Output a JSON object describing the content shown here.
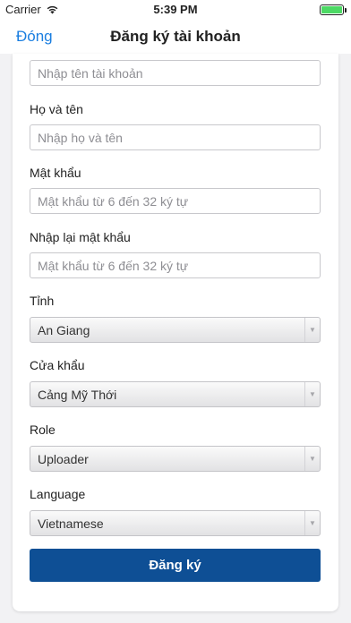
{
  "status_bar": {
    "carrier": "Carrier",
    "time": "5:39 PM",
    "battery_level": 1.0
  },
  "nav": {
    "back_label": "Đóng",
    "title": "Đăng ký tài khoản"
  },
  "form": {
    "username": {
      "placeholder": "Nhập tên tài khoản"
    },
    "fullname": {
      "label": "Họ và tên",
      "placeholder": "Nhập họ và tên"
    },
    "password": {
      "label": "Mật khẩu",
      "placeholder": "Mật khẩu từ 6 đến 32 ký tự"
    },
    "confirm_password": {
      "label": "Nhập lại mật khẩu",
      "placeholder": "Mật khẩu từ 6 đến 32 ký tự"
    },
    "province": {
      "label": "Tỉnh",
      "value": "An Giang"
    },
    "border_gate": {
      "label": "Cửa khẩu",
      "value": "Cảng Mỹ Thới"
    },
    "role": {
      "label": "Role",
      "value": "Uploader"
    },
    "language": {
      "label": "Language",
      "value": "Vietnamese"
    },
    "submit_label": "Đăng ký"
  },
  "colors": {
    "accent": "#1a7ee0",
    "primary_button": "#0e4f95",
    "battery": "#4cd964"
  }
}
